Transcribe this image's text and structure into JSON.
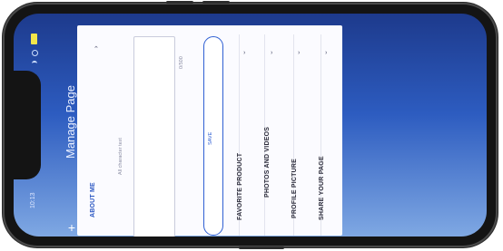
{
  "status": {
    "time": "10:13"
  },
  "header": {
    "title": "Manage Page"
  },
  "content": {
    "about_me_label": "ABOUT ME",
    "textarea_placeholder": "All character text",
    "char_count": "0/500",
    "save_label": "SAVE",
    "menu_items": [
      {
        "label": "FAVORITE PRODUCT"
      },
      {
        "label": "PHOTOS AND VIDEOS"
      },
      {
        "label": "PROFILE PICTURE"
      },
      {
        "label": "SHARE YOUR PAGE"
      }
    ]
  },
  "colors": {
    "header_gradient_top": "#1d3a8c",
    "accent": "#2f5fd3",
    "battery": "#f2e64a"
  },
  "icons": [
    "plus-icon",
    "chevron-icon",
    "battery-icon",
    "wifi-icon",
    "signal-icon"
  ]
}
